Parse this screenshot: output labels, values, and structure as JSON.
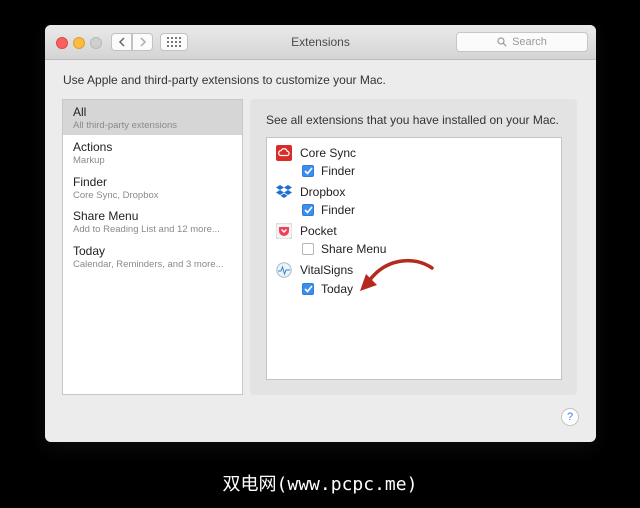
{
  "window": {
    "title": "Extensions",
    "search_placeholder": "Search"
  },
  "description": "Use Apple and third-party extensions to customize your Mac.",
  "sidebar": {
    "items": [
      {
        "title": "All",
        "subtitle": "All third-party extensions",
        "selected": true
      },
      {
        "title": "Actions",
        "subtitle": "Markup"
      },
      {
        "title": "Finder",
        "subtitle": "Core Sync, Dropbox"
      },
      {
        "title": "Share Menu",
        "subtitle": "Add to Reading List and 12 more..."
      },
      {
        "title": "Today",
        "subtitle": "Calendar, Reminders, and 3 more..."
      }
    ]
  },
  "main": {
    "description": "See all extensions that you have installed on your Mac.",
    "apps": [
      {
        "name": "Core Sync",
        "icon": "adobe-creative-cloud-icon",
        "extension": {
          "label": "Finder",
          "checked": true
        }
      },
      {
        "name": "Dropbox",
        "icon": "dropbox-icon",
        "extension": {
          "label": "Finder",
          "checked": true
        }
      },
      {
        "name": "Pocket",
        "icon": "pocket-icon",
        "extension": {
          "label": "Share Menu",
          "checked": false
        }
      },
      {
        "name": "VitalSigns",
        "icon": "vitalsigns-icon",
        "extension": {
          "label": "Today",
          "checked": true
        }
      }
    ]
  },
  "help_label": "?",
  "watermark": "双电网(www.pcpc.me)",
  "colors": {
    "checkbox_accent": "#3b8ef0",
    "arrow": "#b52a1c"
  }
}
